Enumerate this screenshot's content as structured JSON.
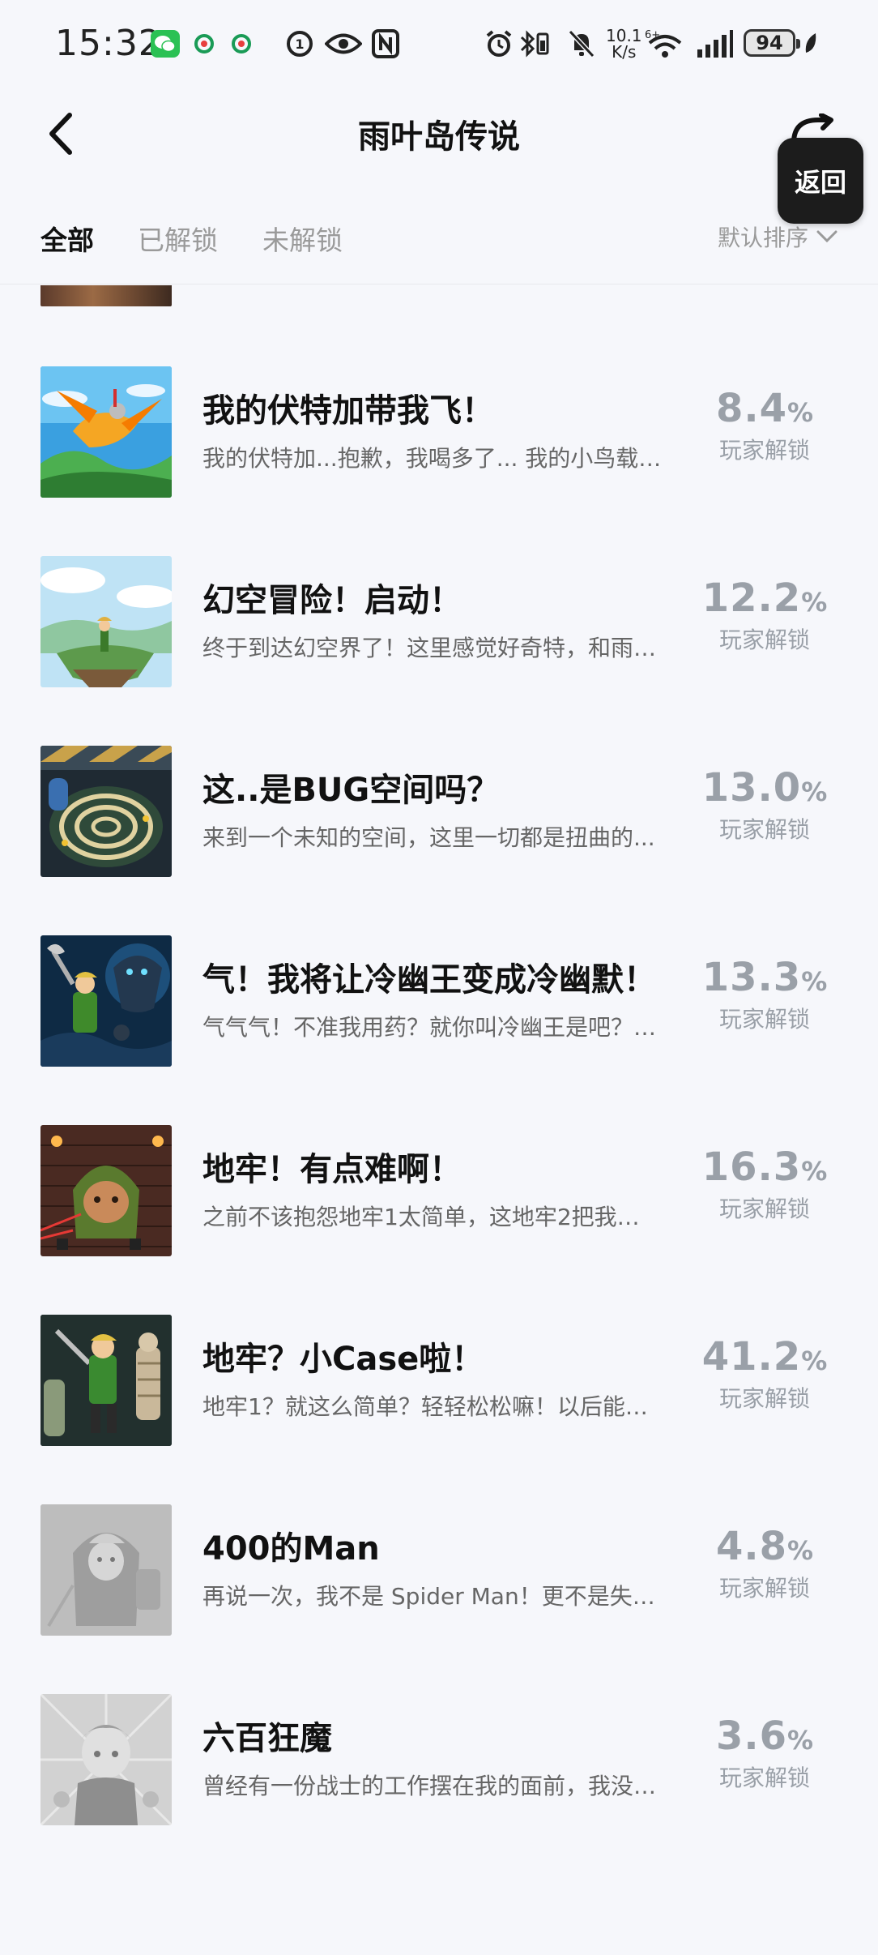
{
  "status_bar": {
    "time": "15:32",
    "net_speed_value": "10.1",
    "net_speed_unit": "K/s",
    "battery": "94"
  },
  "header": {
    "title": "雨叶岛传说",
    "floating_return_label": "返回"
  },
  "tabs": [
    {
      "label": "全部",
      "active": true
    },
    {
      "label": "已解锁",
      "active": false
    },
    {
      "label": "未解锁",
      "active": false
    }
  ],
  "sort_label": "默认排序",
  "unlock_label": "玩家解锁",
  "percent_symbol": "%",
  "achievements": [
    {
      "title": "我的伏特加带我飞！",
      "desc": "我的伏特加...抱歉，我喝多了... 我的小鸟载…",
      "percent": "8.4",
      "unlocked": true,
      "theme": "bird"
    },
    {
      "title": "幻空冒险！启动！",
      "desc": "终于到达幻空界了！这里感觉好奇特，和雨…",
      "percent": "12.2",
      "unlocked": true,
      "theme": "sky"
    },
    {
      "title": "这..是BUG空间吗？",
      "desc": "来到一个未知的空间，这里一切都是扭曲的...",
      "percent": "13.0",
      "unlocked": true,
      "theme": "maze"
    },
    {
      "title": "气！我将让冷幽王变成冷幽默！",
      "desc": "气气气！不准我用药？就你叫冷幽王是吧？…",
      "percent": "13.3",
      "unlocked": true,
      "theme": "battle"
    },
    {
      "title": "地牢！有点难啊！",
      "desc": "之前不该抱怨地牢1太简单，这地牢2把我…",
      "percent": "16.3",
      "unlocked": true,
      "theme": "dungeon"
    },
    {
      "title": "地牢？小Case啦！",
      "desc": "地牢1？就这么简单？轻轻松松嘛！以后能…",
      "percent": "41.2",
      "unlocked": true,
      "theme": "hero"
    },
    {
      "title": "400的Man",
      "desc": "再说一次，我不是 Spider Man！更不是失…",
      "percent": "4.8",
      "unlocked": false,
      "theme": "gray1"
    },
    {
      "title": "六百狂魔",
      "desc": "曾经有一份战士的工作摆在我的面前，我没…",
      "percent": "3.6",
      "unlocked": false,
      "theme": "gray2"
    }
  ]
}
